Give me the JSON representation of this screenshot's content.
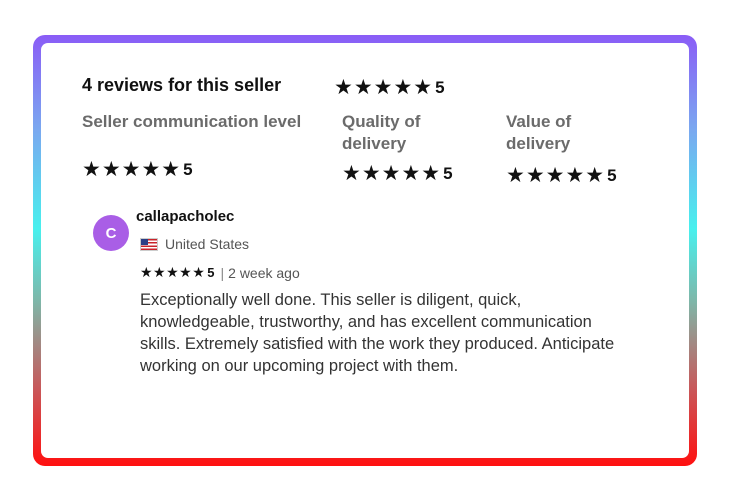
{
  "summary": {
    "heading": "4 reviews for this seller",
    "overall_stars": "★★★★★",
    "overall_rating": "5"
  },
  "categories": [
    {
      "label": "Seller communication level",
      "stars": "★★★★★",
      "rating": "5"
    },
    {
      "label": "Quality of delivery",
      "stars": "★★★★★",
      "rating": "5"
    },
    {
      "label": "Value of delivery",
      "stars": "★★★★★",
      "rating": "5"
    }
  ],
  "review": {
    "avatar_initial": "C",
    "avatar_color": "#a95ee6",
    "username": "callapacholec",
    "country": "United States",
    "stars": "★★★★★",
    "rating": "5",
    "separator": "|",
    "time_ago": "2 week ago",
    "text": "Exceptionally well done. This seller is diligent, quick, knowledgeable, trustworthy, and has excellent communication skills. Extremely satisfied with the work they produced. Anticipate working on our upcoming project with them."
  },
  "colors": {
    "border_gradient_top": "#8a5cf6",
    "border_gradient_mid": "#48f0ee",
    "border_gradient_bottom": "#ff1010"
  }
}
